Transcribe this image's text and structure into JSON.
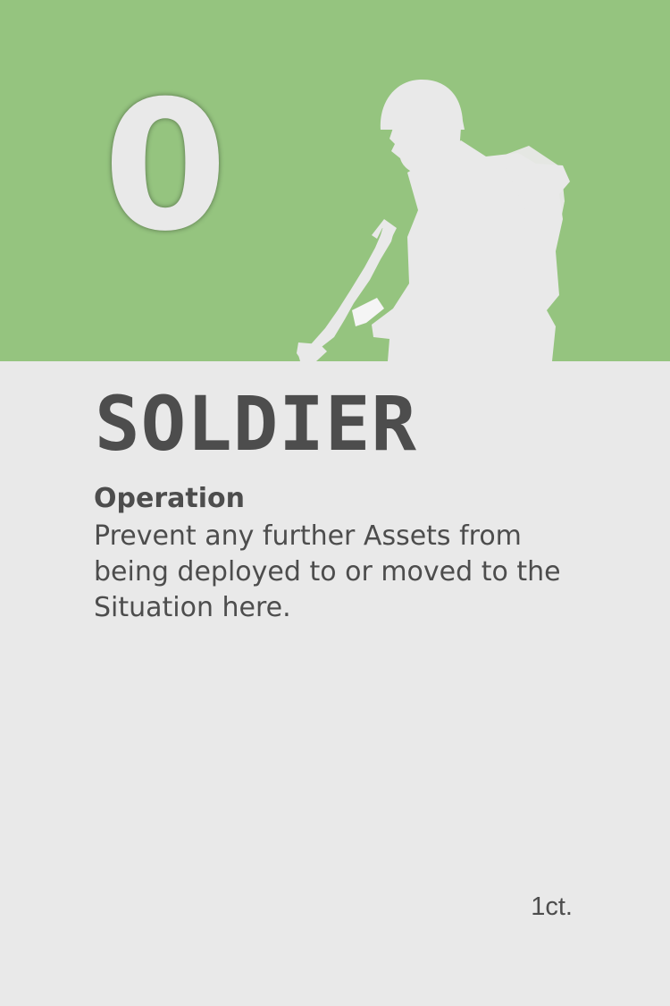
{
  "card": {
    "cost": "0",
    "title": "SOLDIER",
    "ability": {
      "name": "Operation",
      "text": "Prevent any further Assets from being deployed to or moved to the Situation here."
    },
    "count": "1ct."
  },
  "colors": {
    "header": "#95c47f",
    "body": "#e9e9e9",
    "text": "#4d4d4d",
    "art": "#e9e9e9"
  },
  "icons": {
    "art": "soldier-silhouette-icon"
  }
}
